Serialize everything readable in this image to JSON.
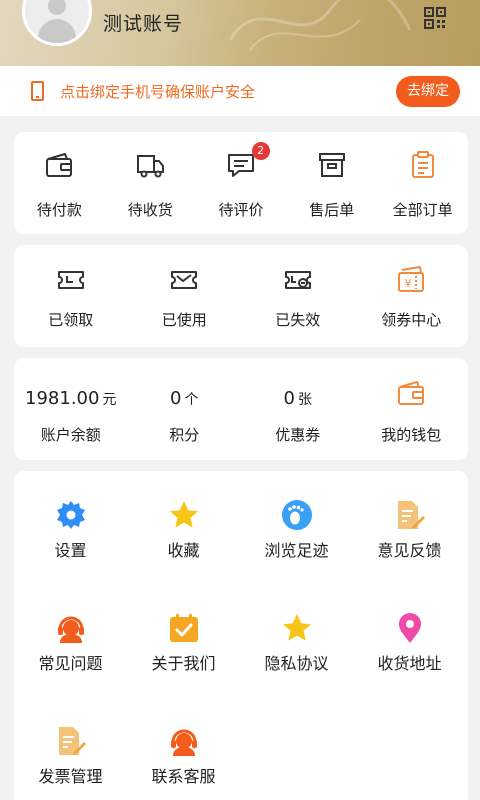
{
  "header": {
    "account_name": "测试账号"
  },
  "bind_bar": {
    "text": "点击绑定手机号确保账户安全",
    "button": "去绑定"
  },
  "orders": [
    {
      "label": "待付款",
      "icon": "wallet-icon"
    },
    {
      "label": "待收货",
      "icon": "truck-icon"
    },
    {
      "label": "待评价",
      "icon": "comment-icon",
      "badge": "2"
    },
    {
      "label": "售后单",
      "icon": "archive-box-icon"
    },
    {
      "label": "全部订单",
      "icon": "clipboard-icon"
    }
  ],
  "coupons": [
    {
      "label": "已领取",
      "icon": "ticket-clock-icon"
    },
    {
      "label": "已使用",
      "icon": "ticket-check-icon"
    },
    {
      "label": "已失效",
      "icon": "ticket-expired-icon"
    },
    {
      "label": "领券中心",
      "icon": "coupon-center-icon"
    }
  ],
  "assets": [
    {
      "value": "1981.00",
      "unit": "元",
      "label": "账户余额"
    },
    {
      "value": "0",
      "unit": "个",
      "label": "积分"
    },
    {
      "value": "0",
      "unit": "张",
      "label": "优惠券"
    },
    {
      "label": "我的钱包",
      "icon": "wallet-icon"
    }
  ],
  "menu": [
    {
      "label": "设置",
      "icon": "gear-icon"
    },
    {
      "label": "收藏",
      "icon": "star-icon"
    },
    {
      "label": "浏览足迹",
      "icon": "footprint-icon"
    },
    {
      "label": "意见反馈",
      "icon": "feedback-doc-icon"
    },
    {
      "label": "常见问题",
      "icon": "headset-icon"
    },
    {
      "label": "关于我们",
      "icon": "calendar-check-icon"
    },
    {
      "label": "隐私协议",
      "icon": "star-icon"
    },
    {
      "label": "收货地址",
      "icon": "location-pin-icon"
    },
    {
      "label": "发票管理",
      "icon": "invoice-doc-icon"
    },
    {
      "label": "联系客服",
      "icon": "headset-icon"
    }
  ],
  "colors": {
    "accent": "#f25c1c",
    "icon_orange": "#f08a3c",
    "star": "#f5c518",
    "blue": "#2f8df5",
    "pink": "#f04aa8"
  }
}
